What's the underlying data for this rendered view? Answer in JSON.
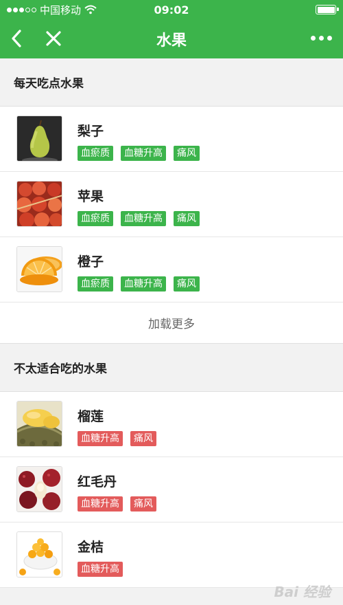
{
  "status": {
    "carrier": "中国移动",
    "time": "09:02"
  },
  "nav": {
    "title": "水果"
  },
  "sections": [
    {
      "title": "每天吃点水果",
      "items": [
        {
          "name": "梨子",
          "tags": [
            "血瘀质",
            "血糖升高",
            "痛风"
          ]
        },
        {
          "name": "苹果",
          "tags": [
            "血瘀质",
            "血糖升高",
            "痛风"
          ]
        },
        {
          "name": "橙子",
          "tags": [
            "血瘀质",
            "血糖升高",
            "痛风"
          ]
        }
      ],
      "load_more": "加载更多"
    },
    {
      "title": "不太适合吃的水果",
      "items": [
        {
          "name": "榴莲",
          "tags": [
            "血糖升高",
            "痛风"
          ]
        },
        {
          "name": "红毛丹",
          "tags": [
            "血糖升高",
            "痛风"
          ]
        },
        {
          "name": "金桔",
          "tags": [
            "血糖升高"
          ]
        }
      ]
    }
  ],
  "colors": {
    "brand_green": "#3cb44b",
    "tag_green": "#3cb44b",
    "tag_red": "#e35b5b"
  },
  "watermark": "Bai 经验"
}
